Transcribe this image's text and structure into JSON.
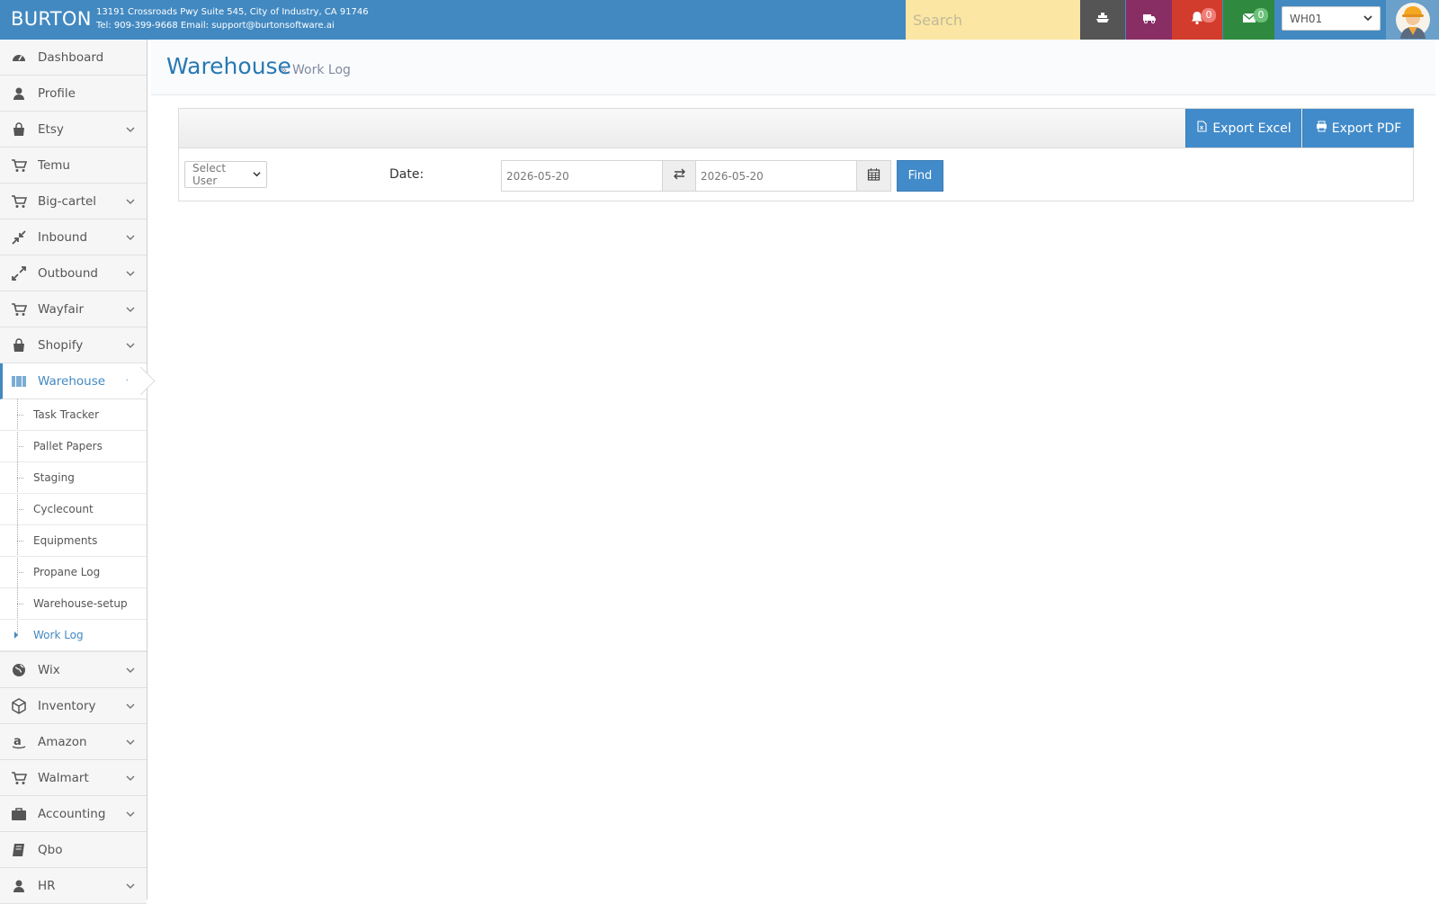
{
  "header": {
    "brand": "BURTON",
    "address_line": "13191 Crossroads Pwy Suite 545, City of Industry, CA 91746",
    "contact_line": "Tel: 909-399-9668 Email: support@burtonsoftware.ai",
    "search_placeholder": "Search",
    "notifications_count": "0",
    "messages_count": "0",
    "warehouse_selected": "WH01"
  },
  "sidebar": {
    "items_top": [
      {
        "label": "Dashboard"
      },
      {
        "label": "Profile"
      },
      {
        "label": "Etsy"
      },
      {
        "label": "Temu"
      },
      {
        "label": "Big-cartel"
      },
      {
        "label": "Inbound"
      },
      {
        "label": "Outbound"
      },
      {
        "label": "Wayfair"
      },
      {
        "label": "Shopify"
      }
    ],
    "active": {
      "label": "Warehouse"
    },
    "submenu": [
      {
        "label": "Task Tracker"
      },
      {
        "label": "Pallet Papers"
      },
      {
        "label": "Staging"
      },
      {
        "label": "Cyclecount"
      },
      {
        "label": "Equipments"
      },
      {
        "label": "Propane Log"
      },
      {
        "label": "Warehouse-setup"
      },
      {
        "label": "Work Log"
      }
    ],
    "items_bottom": [
      {
        "label": "Wix"
      },
      {
        "label": "Inventory"
      },
      {
        "label": "Amazon"
      },
      {
        "label": "Walmart"
      },
      {
        "label": "Accounting"
      },
      {
        "label": "Qbo"
      },
      {
        "label": "HR"
      }
    ]
  },
  "page": {
    "title": "Warehouse",
    "separator": "»",
    "subtitle": "Work Log"
  },
  "toolbar": {
    "export_excel": "Export Excel",
    "export_pdf": "Export PDF"
  },
  "filters": {
    "user_select": "Select User",
    "date_label": "Date:",
    "date_from": "2026-05-20",
    "date_to": "2026-05-20",
    "find_label": "Find"
  },
  "colors": {
    "topbar": "#4289c1",
    "search_bg": "#fbe6a3",
    "btn_dark": "#555555",
    "btn_purple": "#892e65",
    "btn_red": "#d23c2c",
    "btn_green": "#2f8a3f",
    "primary": "#428bca"
  }
}
